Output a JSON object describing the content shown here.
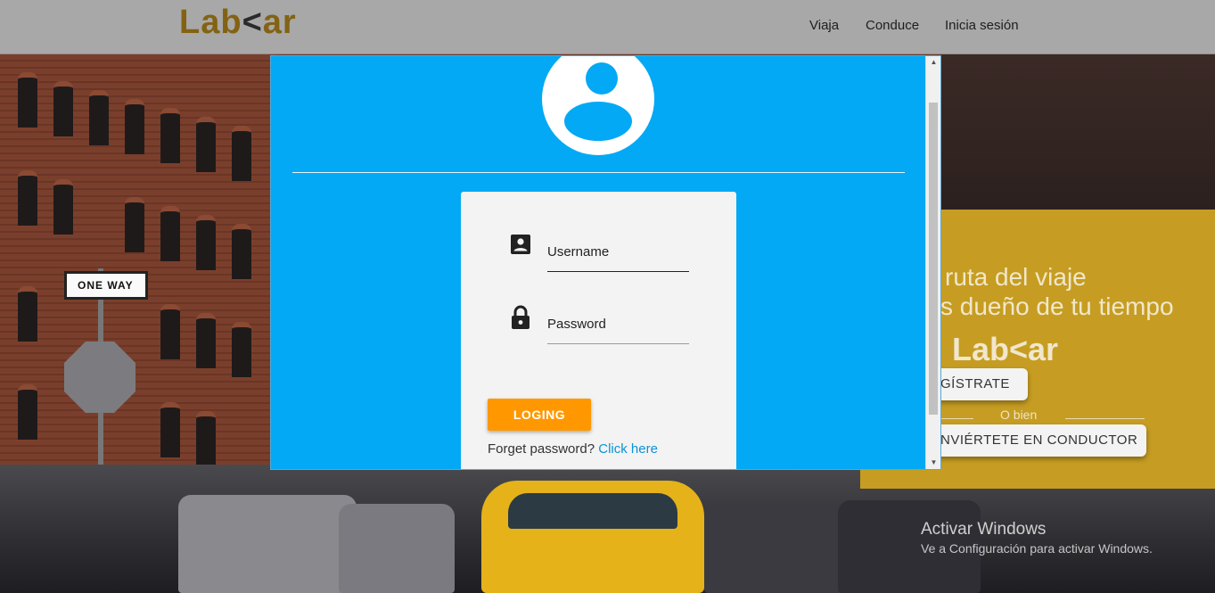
{
  "nav": {
    "logo_left": "Lab",
    "logo_chevron": "<",
    "logo_right": "ar",
    "links": [
      "Viaja",
      "Conduce",
      "Inicia sesión"
    ]
  },
  "promo": {
    "line1": "ruta del viaje",
    "line2": "s dueño de tu tiempo",
    "logo_text": "Lab<ar",
    "register_label": "GÍSTRATE",
    "or_text": "O bien",
    "driver_label": "NVIÉRTETE EN CONDUCTOR"
  },
  "background": {
    "sign_text": "ONE WAY"
  },
  "login": {
    "username_label": "Username",
    "password_label": "Password",
    "button_label": "LOGING",
    "forget_text": "Forget password?",
    "forget_link": "Click here"
  },
  "watermark": {
    "title": "Activar Windows",
    "subtitle": "Ve a Configuración para activar Windows."
  },
  "colors": {
    "modal_bg": "#03a9f4",
    "login_button": "#ff9800",
    "promo_bg": "#c69d22",
    "link": "#0a93d6"
  }
}
